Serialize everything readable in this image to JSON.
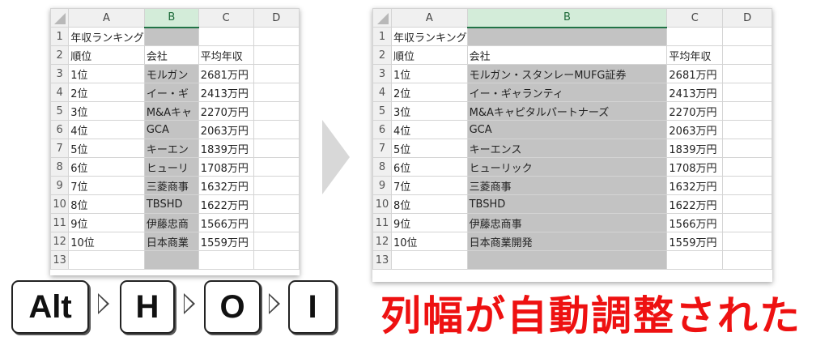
{
  "left_sheet": {
    "columns": [
      "A",
      "B",
      "C",
      "D"
    ],
    "rows": [
      {
        "num": "1",
        "a": "年収ランキング",
        "b": "",
        "c": ""
      },
      {
        "num": "2",
        "a": "順位",
        "b": "会社",
        "c": "平均年収"
      },
      {
        "num": "3",
        "a": "1位",
        "b": "モルガン",
        "c": "2681万円"
      },
      {
        "num": "4",
        "a": "2位",
        "b": "イー・ギ",
        "c": "2413万円"
      },
      {
        "num": "5",
        "a": "3位",
        "b": "M&Aキャ",
        "c": "2270万円"
      },
      {
        "num": "6",
        "a": "4位",
        "b": "GCA",
        "c": "2063万円"
      },
      {
        "num": "7",
        "a": "5位",
        "b": "キーエン",
        "c": "1839万円"
      },
      {
        "num": "8",
        "a": "6位",
        "b": "ヒューリ",
        "c": "1708万円"
      },
      {
        "num": "9",
        "a": "7位",
        "b": "三菱商事",
        "c": "1632万円"
      },
      {
        "num": "10",
        "a": "8位",
        "b": "TBSHD",
        "c": "1622万円"
      },
      {
        "num": "11",
        "a": "9位",
        "b": "伊藤忠商",
        "c": "1566万円"
      },
      {
        "num": "12",
        "a": "10位",
        "b": "日本商業",
        "c": "1559万円"
      },
      {
        "num": "13",
        "a": "",
        "b": "",
        "c": ""
      }
    ]
  },
  "right_sheet": {
    "columns": [
      "A",
      "B",
      "C",
      "D"
    ],
    "rows": [
      {
        "num": "1",
        "a": "年収ランキング",
        "b": "",
        "c": ""
      },
      {
        "num": "2",
        "a": "順位",
        "b": "会社",
        "c": "平均年収"
      },
      {
        "num": "3",
        "a": "1位",
        "b": "モルガン・スタンレーMUFG証券",
        "c": "2681万円"
      },
      {
        "num": "4",
        "a": "2位",
        "b": "イー・ギャランティ",
        "c": "2413万円"
      },
      {
        "num": "5",
        "a": "3位",
        "b": "M&Aキャピタルパートナーズ",
        "c": "2270万円"
      },
      {
        "num": "6",
        "a": "4位",
        "b": "GCA",
        "c": "2063万円"
      },
      {
        "num": "7",
        "a": "5位",
        "b": "キーエンス",
        "c": "1839万円"
      },
      {
        "num": "8",
        "a": "6位",
        "b": "ヒューリック",
        "c": "1708万円"
      },
      {
        "num": "9",
        "a": "7位",
        "b": "三菱商事",
        "c": "1632万円"
      },
      {
        "num": "10",
        "a": "8位",
        "b": "TBSHD",
        "c": "1622万円"
      },
      {
        "num": "11",
        "a": "9位",
        "b": "伊藤忠商事",
        "c": "1566万円"
      },
      {
        "num": "12",
        "a": "10位",
        "b": "日本商業開発",
        "c": "1559万円"
      },
      {
        "num": "13",
        "a": "",
        "b": "",
        "c": ""
      }
    ]
  },
  "shortcut": {
    "keys": [
      "Alt",
      "H",
      "O",
      "I"
    ]
  },
  "caption": "列幅が自動調整された",
  "colors": {
    "selection_border": "#217346",
    "selection_fill": "#c3c3c3",
    "caption": "#ee1111"
  },
  "icons": [
    "corner-select-icon",
    "arrow-right-icon",
    "key-separator-icon"
  ]
}
